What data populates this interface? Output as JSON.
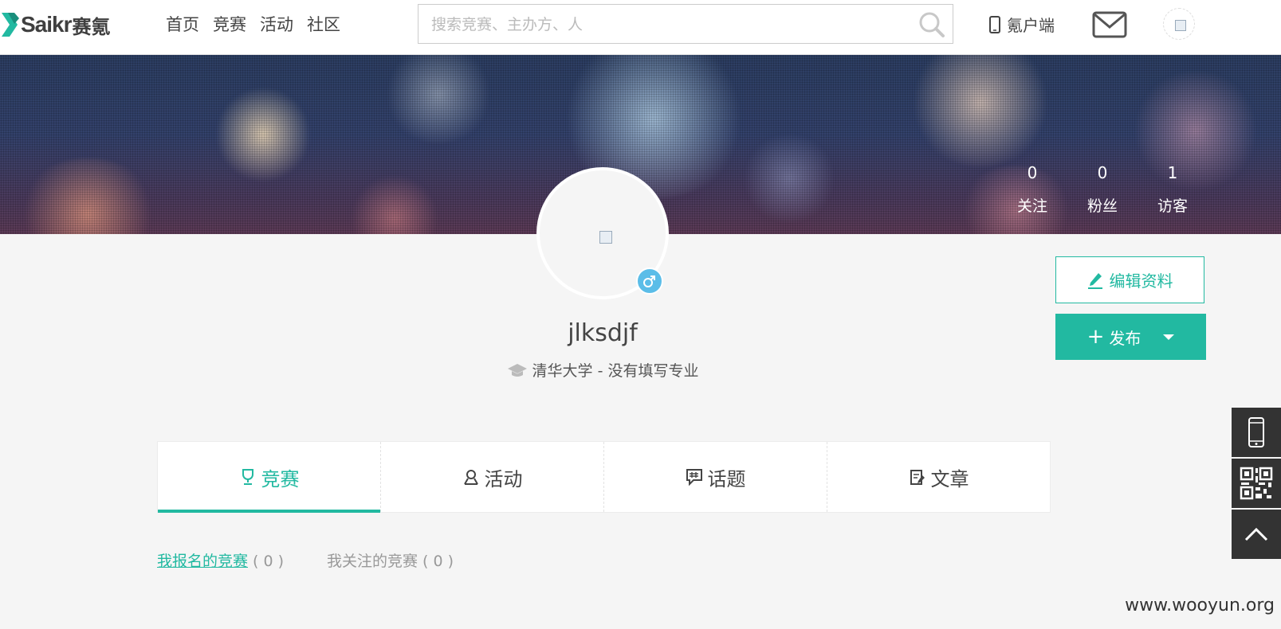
{
  "header": {
    "logo_text": "Saikr",
    "logo_cn": "赛氪",
    "nav": [
      {
        "label": "首页"
      },
      {
        "label": "竞赛"
      },
      {
        "label": "活动"
      },
      {
        "label": "社区"
      }
    ],
    "search": {
      "placeholder": "搜索竞赛、主办方、人",
      "value": ""
    },
    "client_label": "氪户端"
  },
  "banner": {
    "stats": [
      {
        "num": "0",
        "label": "关注"
      },
      {
        "num": "0",
        "label": "粉丝"
      },
      {
        "num": "1",
        "label": "访客"
      }
    ]
  },
  "profile": {
    "username": "jlksdjf",
    "school": "清华大学 - 没有填写专业",
    "gender": "male",
    "edit_label": "编辑资料",
    "publish_label": "发布"
  },
  "tabs": [
    {
      "label": "竞赛",
      "icon": "trophy-icon",
      "active": true
    },
    {
      "label": "活动",
      "icon": "activity-icon",
      "active": false
    },
    {
      "label": "话题",
      "icon": "topic-icon",
      "active": false
    },
    {
      "label": "文章",
      "icon": "article-icon",
      "active": false
    }
  ],
  "subtabs": [
    {
      "label": "我报名的竞赛",
      "count": "( 0 )",
      "active": true
    },
    {
      "label": "我关注的竞赛",
      "count": "( 0 )",
      "active": false
    }
  ],
  "watermark": "www.wooyun.org",
  "colors": {
    "accent": "#22b9a1",
    "gender_male": "#5bbde8",
    "sidebar": "#333333"
  }
}
